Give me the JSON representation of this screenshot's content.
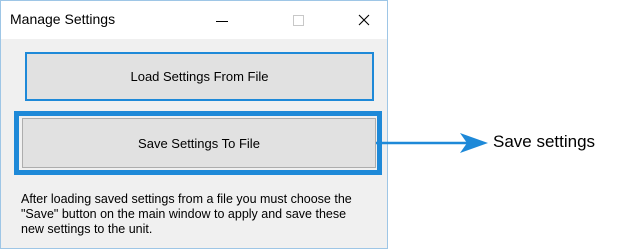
{
  "window": {
    "title": "Manage Settings",
    "controls": {
      "minimize": "minimize-icon",
      "maximize": "maximize-icon",
      "close": "close-icon"
    }
  },
  "buttons": {
    "load": "Load Settings From File",
    "save": "Save Settings To File"
  },
  "note": "After loading saved settings from a file you must choose the \"Save\" button on the main window to apply and save these new settings to the unit.",
  "annotation": {
    "label": "Save settings",
    "color": "#1e89d8"
  }
}
